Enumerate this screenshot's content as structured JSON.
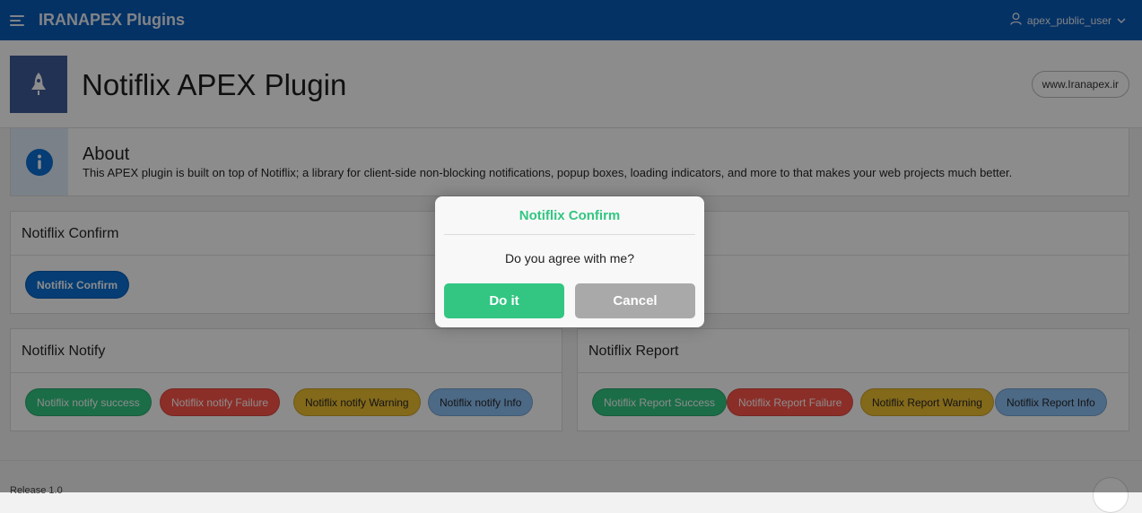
{
  "header": {
    "app_title": "IRANAPEX Plugins",
    "user_name": "apex_public_user"
  },
  "hero": {
    "title": "Notiflix APEX Plugin",
    "site_link": "www.Iranapex.ir"
  },
  "about": {
    "title": "About",
    "text": "This APEX plugin is built on top of Notiflix; a library for client-side non-blocking notifications, popup boxes, loading indicators, and more to that makes your web projects much better."
  },
  "confirm_region": {
    "title": "Notiflix Confirm",
    "button": "Notiflix Confirm"
  },
  "notify_region": {
    "title": "Notiflix Notify",
    "buttons": [
      "Notiflix notify success",
      "Notiflix notify Failure",
      "Notiflix notify Warning",
      "Notiflix notify Info"
    ]
  },
  "report_region": {
    "title": "Notiflix Report",
    "buttons": [
      "Notiflix Report Success",
      "Notiflix Report Failure",
      "Notiflix Report Warning",
      "Notiflix Report Info"
    ]
  },
  "footer": {
    "release": "Release 1.0"
  },
  "modal": {
    "title": "Notiflix Confirm",
    "message": "Do you agree with me?",
    "ok_label": "Do it",
    "cancel_label": "Cancel"
  },
  "colors": {
    "header_bg": "#0a5cb8",
    "success": "#32c682",
    "failure": "#ff5549",
    "warning": "#eebf31",
    "info": "#8bc0f5",
    "cancel": "#a9a9a9",
    "primary": "#0a6fd4"
  }
}
